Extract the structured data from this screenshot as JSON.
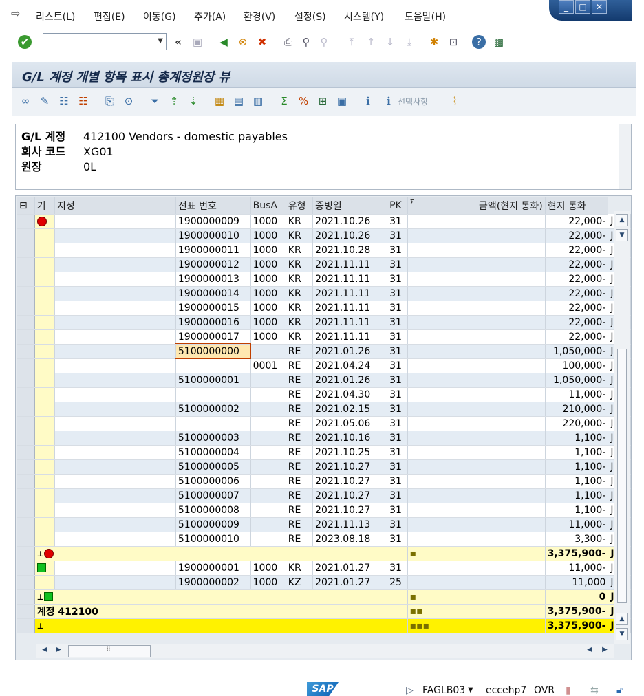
{
  "menu": {
    "items": [
      "리스트(L)",
      "편집(E)",
      "이동(G)",
      "추가(A)",
      "환경(V)",
      "설정(S)",
      "시스템(Y)",
      "도움말(H)"
    ]
  },
  "toolbar": {
    "back_glyph": "«"
  },
  "title": "G/L 계정 개별 항목 표시 총계정원장 뷰",
  "app_toolbar": {
    "selection_label": "선택사항"
  },
  "header": {
    "gl_label": "G/L 계정",
    "gl_value": "412100 Vendors - domestic payables",
    "cc_label": "회사 코드",
    "cc_value": "XG01",
    "ledger_label": "원장",
    "ledger_value": "0L"
  },
  "grid": {
    "columns": [
      "기",
      "지정",
      "전표 번호",
      "BusA",
      "유형",
      "증빙일",
      "PK",
      "Σ",
      "금액(현지 통화)",
      "현지 통화"
    ],
    "rows": [
      {
        "kind": "item",
        "status": "red",
        "doc": "1900000009",
        "busa": "1000",
        "type": "KR",
        "date": "2021.10.26",
        "pk": "31",
        "amount": "22,000-",
        "cur": "JPY"
      },
      {
        "kind": "item",
        "doc": "1900000010",
        "busa": "1000",
        "type": "KR",
        "date": "2021.10.26",
        "pk": "31",
        "amount": "22,000-",
        "cur": "JPY"
      },
      {
        "kind": "item",
        "doc": "1900000011",
        "busa": "1000",
        "type": "KR",
        "date": "2021.10.28",
        "pk": "31",
        "amount": "22,000-",
        "cur": "JPY"
      },
      {
        "kind": "item",
        "doc": "1900000012",
        "busa": "1000",
        "type": "KR",
        "date": "2021.11.11",
        "pk": "31",
        "amount": "22,000-",
        "cur": "JPY"
      },
      {
        "kind": "item",
        "doc": "1900000013",
        "busa": "1000",
        "type": "KR",
        "date": "2021.11.11",
        "pk": "31",
        "amount": "22,000-",
        "cur": "JPY"
      },
      {
        "kind": "item",
        "doc": "1900000014",
        "busa": "1000",
        "type": "KR",
        "date": "2021.11.11",
        "pk": "31",
        "amount": "22,000-",
        "cur": "JPY"
      },
      {
        "kind": "item",
        "doc": "1900000015",
        "busa": "1000",
        "type": "KR",
        "date": "2021.11.11",
        "pk": "31",
        "amount": "22,000-",
        "cur": "JPY"
      },
      {
        "kind": "item",
        "doc": "1900000016",
        "busa": "1000",
        "type": "KR",
        "date": "2021.11.11",
        "pk": "31",
        "amount": "22,000-",
        "cur": "JPY"
      },
      {
        "kind": "item",
        "doc": "1900000017",
        "busa": "1000",
        "type": "KR",
        "date": "2021.11.11",
        "pk": "31",
        "amount": "22,000-",
        "cur": "JPY"
      },
      {
        "kind": "item",
        "doc": "5100000000",
        "busa": "",
        "type": "RE",
        "date": "2021.01.26",
        "pk": "31",
        "amount": "1,050,000-",
        "cur": "JPY",
        "focus": true
      },
      {
        "kind": "item",
        "doc": "",
        "busa": "0001",
        "type": "RE",
        "date": "2021.04.24",
        "pk": "31",
        "amount": "100,000-",
        "cur": "JPY"
      },
      {
        "kind": "item",
        "doc": "5100000001",
        "busa": "",
        "type": "RE",
        "date": "2021.01.26",
        "pk": "31",
        "amount": "1,050,000-",
        "cur": "JPY"
      },
      {
        "kind": "item",
        "doc": "",
        "busa": "",
        "type": "RE",
        "date": "2021.04.30",
        "pk": "31",
        "amount": "11,000-",
        "cur": "JPY"
      },
      {
        "kind": "item",
        "doc": "5100000002",
        "busa": "",
        "type": "RE",
        "date": "2021.02.15",
        "pk": "31",
        "amount": "210,000-",
        "cur": "JPY"
      },
      {
        "kind": "item",
        "doc": "",
        "busa": "",
        "type": "RE",
        "date": "2021.05.06",
        "pk": "31",
        "amount": "220,000-",
        "cur": "JPY"
      },
      {
        "kind": "item",
        "doc": "5100000003",
        "busa": "",
        "type": "RE",
        "date": "2021.10.16",
        "pk": "31",
        "amount": "1,100-",
        "cur": "JPY"
      },
      {
        "kind": "item",
        "doc": "5100000004",
        "busa": "",
        "type": "RE",
        "date": "2021.10.25",
        "pk": "31",
        "amount": "1,100-",
        "cur": "JPY"
      },
      {
        "kind": "item",
        "doc": "5100000005",
        "busa": "",
        "type": "RE",
        "date": "2021.10.27",
        "pk": "31",
        "amount": "1,100-",
        "cur": "JPY"
      },
      {
        "kind": "item",
        "doc": "5100000006",
        "busa": "",
        "type": "RE",
        "date": "2021.10.27",
        "pk": "31",
        "amount": "1,100-",
        "cur": "JPY"
      },
      {
        "kind": "item",
        "doc": "5100000007",
        "busa": "",
        "type": "RE",
        "date": "2021.10.27",
        "pk": "31",
        "amount": "1,100-",
        "cur": "JPY"
      },
      {
        "kind": "item",
        "doc": "5100000008",
        "busa": "",
        "type": "RE",
        "date": "2021.10.27",
        "pk": "31",
        "amount": "1,100-",
        "cur": "JPY"
      },
      {
        "kind": "item",
        "doc": "5100000009",
        "busa": "",
        "type": "RE",
        "date": "2021.11.13",
        "pk": "31",
        "amount": "11,000-",
        "cur": "JPY"
      },
      {
        "kind": "item",
        "doc": "5100000010",
        "busa": "",
        "type": "RE",
        "date": "2023.08.18",
        "pk": "31",
        "amount": "3,300-",
        "cur": "JPY"
      },
      {
        "kind": "sub",
        "status": "red",
        "dots": "▪",
        "amount": "3,375,900-",
        "cur": "JPY"
      },
      {
        "kind": "item",
        "status": "green",
        "doc": "1900000001",
        "busa": "1000",
        "type": "KR",
        "date": "2021.01.27",
        "pk": "31",
        "amount": "11,000-",
        "cur": "JPY"
      },
      {
        "kind": "item",
        "doc": "1900000002",
        "busa": "1000",
        "type": "KZ",
        "date": "2021.01.27",
        "pk": "25",
        "amount": "11,000",
        "cur": "JPY"
      },
      {
        "kind": "sub",
        "status": "green",
        "dots": "▪",
        "amount": "0",
        "cur": "JPY"
      },
      {
        "kind": "sub",
        "label": "계정 412100",
        "dots": "▪▪",
        "amount": "3,375,900-",
        "cur": "JPY"
      },
      {
        "kind": "grand",
        "dots": "▪▪▪",
        "amount": "3,375,900-",
        "cur": "JPY"
      }
    ]
  },
  "status": {
    "tcode": "FAGLB03",
    "server": "eccehp7",
    "mode": "OVR",
    "sap_logo": "SAP"
  }
}
